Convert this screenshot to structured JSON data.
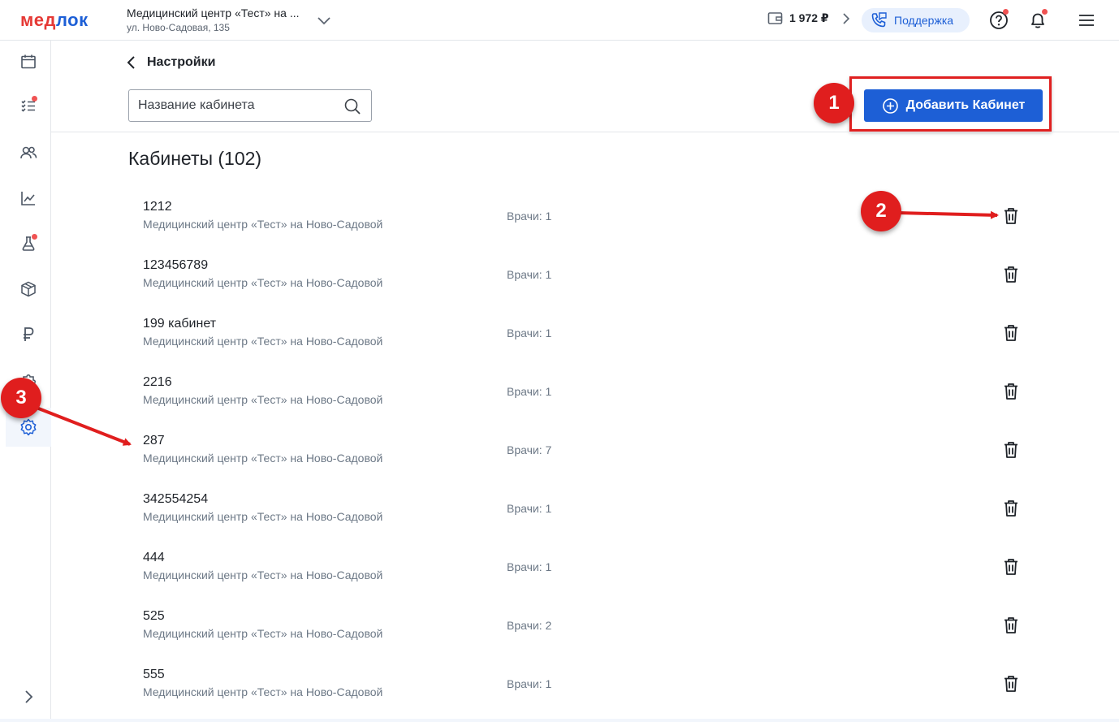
{
  "header": {
    "logo_part1": "мед",
    "logo_part2": "лок",
    "clinic_name": "Медицинский центр «Тест» на ...",
    "clinic_address": "ул. Ново-Садовая, 135",
    "balance": "1 972 ₽",
    "support_label": "Поддержка"
  },
  "page": {
    "back_label": "Настройки",
    "search_placeholder": "Название кабинета",
    "add_button_label": "Добавить Кабинет",
    "list_title": "Кабинеты (102)"
  },
  "rooms": [
    {
      "name": "1212",
      "clinic": "Медицинский центр «Тест» на Ново-Садовой",
      "doctors": "Врачи: 1"
    },
    {
      "name": "123456789",
      "clinic": "Медицинский центр «Тест» на Ново-Садовой",
      "doctors": "Врачи: 1"
    },
    {
      "name": "199 кабинет",
      "clinic": "Медицинский центр «Тест» на Ново-Садовой",
      "doctors": "Врачи: 1"
    },
    {
      "name": "2216",
      "clinic": "Медицинский центр «Тест» на Ново-Садовой",
      "doctors": "Врачи: 1"
    },
    {
      "name": "287",
      "clinic": "Медицинский центр «Тест» на Ново-Садовой",
      "doctors": "Врачи: 7"
    },
    {
      "name": "342554254",
      "clinic": "Медицинский центр «Тест» на Ново-Садовой",
      "doctors": "Врачи: 1"
    },
    {
      "name": "444",
      "clinic": "Медицинский центр «Тест» на Ново-Садовой",
      "doctors": "Врачи: 1"
    },
    {
      "name": "525",
      "clinic": "Медицинский центр «Тест» на Ново-Садовой",
      "doctors": "Врачи: 2"
    },
    {
      "name": "555",
      "clinic": "Медицинский центр «Тест» на Ново-Садовой",
      "doctors": "Врачи: 1"
    }
  ],
  "annotations": {
    "badge1": "1",
    "badge2": "2",
    "badge3": "3"
  },
  "sidebar_icons": [
    "calendar-icon",
    "tasks-icon",
    "patients-icon",
    "analytics-icon",
    "lab-icon",
    "box-icon",
    "ruble-icon",
    "puzzle-icon",
    "gear-icon",
    "expand-icon"
  ],
  "colors": {
    "accent": "#1d5fd6",
    "logo_red": "#e53935",
    "annotation_red": "#e01e1e",
    "notification_dot": "#f05353",
    "secondary_text": "#6c7886"
  }
}
